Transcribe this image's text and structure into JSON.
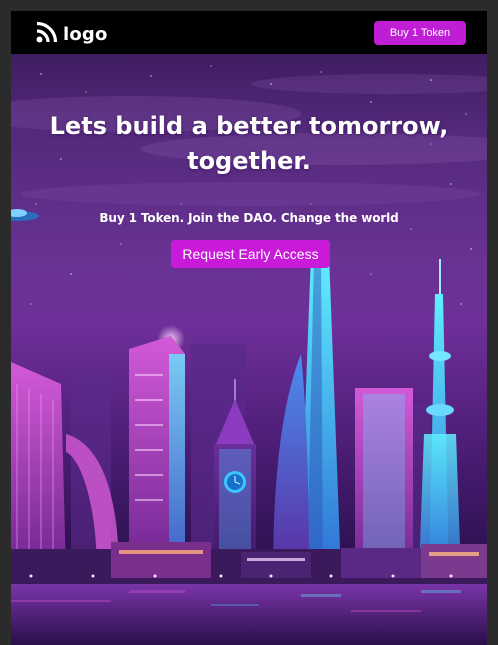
{
  "navbar": {
    "logo_text": "logo",
    "buy_button_label": "Buy 1 Token"
  },
  "hero": {
    "headline_line1": "Lets build a better tomorrow,",
    "headline_line2": "together.",
    "subheadline": "Buy 1 Token. Join the DAO. Change the world",
    "cta_label": "Request Early Access"
  },
  "colors": {
    "accent": "#c81ad8",
    "navbar_bg": "#000000",
    "page_bg": "#2b2b2b"
  },
  "icons": {
    "logo": "rss-feed-icon"
  }
}
